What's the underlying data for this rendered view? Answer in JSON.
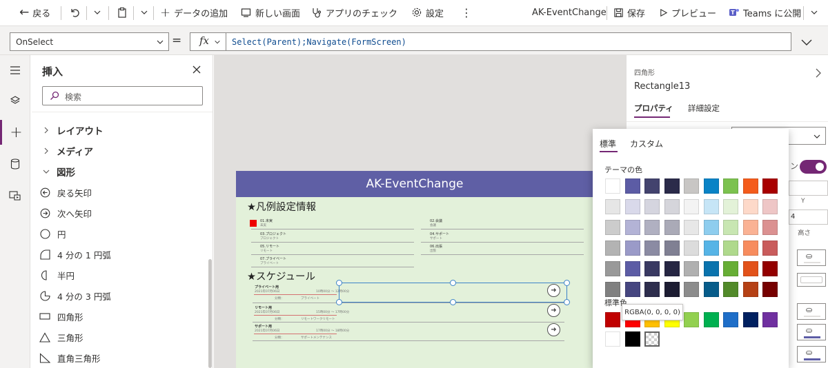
{
  "topbar": {
    "back": "戻る",
    "add_data": "データの追加",
    "new_screen": "新しい画面",
    "app_checker": "アプリのチェック",
    "settings": "設定",
    "app_name": "AK-EventChange",
    "save": "保存",
    "preview": "プレビュー",
    "publish_teams": "Teams に公開"
  },
  "formula_bar": {
    "property": "OnSelect",
    "equals": "=",
    "fx": "fx",
    "formula": "Select(Parent);Navigate(FormScreen)"
  },
  "insert_panel": {
    "title": "挿入",
    "search_placeholder": "検索",
    "categories": [
      "レイアウト",
      "メディア",
      "図形"
    ],
    "items": [
      "戻る矢印",
      "次へ矢印",
      "円",
      "4 分の 1 円弧",
      "半円",
      "4 分の 3 円弧",
      "四角形",
      "三角形",
      "直角三角形"
    ]
  },
  "app_screen": {
    "header": "AK-EventChange",
    "legend_title": "★凡例設定情報",
    "legend_left": [
      {
        "code": "01.未実",
        "sub": "未実"
      },
      {
        "code": "03.プロジェクト",
        "sub": "プロジェクト"
      },
      {
        "code": "05.リモート",
        "sub": "リモート"
      },
      {
        "code": "07.プライベート",
        "sub": "プライベート"
      }
    ],
    "legend_right": [
      {
        "code": "02.会議",
        "sub": "会議"
      },
      {
        "code": "04.サポート",
        "sub": "サポート"
      },
      {
        "code": "06.出張",
        "sub": "出張"
      }
    ],
    "schedule_title": "★スケジュール",
    "schedule": [
      {
        "title": "プライベート用",
        "date": "2021年07月06日",
        "time": "10時00分 ～ 12時00分",
        "tag_label": "分類：",
        "tag": "プライベート"
      },
      {
        "title": "リモート用",
        "date": "2021年07月06日",
        "time": "15時00分 ～ 17時00分",
        "tag_label": "分類：",
        "tag": "リモートワークリモート"
      },
      {
        "title": "サポート用",
        "date": "2021年07月06日",
        "time": "17時00分 ～ 18時00分",
        "tag_label": "分類：",
        "tag": "サポートメンテナンス"
      }
    ]
  },
  "properties_panel": {
    "type": "四角形",
    "name": "Rectangle13",
    "tabs": [
      "プロパティ",
      "詳細設定"
    ],
    "y_label": "Y",
    "height_label": "高さ",
    "value_fragment": "4"
  },
  "color_picker": {
    "tabs": [
      "標準",
      "カスタム"
    ],
    "theme_label": "テーマの色",
    "standard_label": "標準色",
    "tooltip": "RGBA(0, 0, 0, 0)",
    "theme_rows": [
      [
        "#ffffff",
        "#5c5ca5",
        "#43436e",
        "#2b2b4a",
        "#c8c6c4",
        "#0a83c6",
        "#7cc24f",
        "#f45c1c",
        "#a80000"
      ],
      [
        "#e6e6e6",
        "#d9d9ea",
        "#d5d5df",
        "#d5d5db",
        "#f3f3f3",
        "#c6e5f6",
        "#e3f2d8",
        "#fdd9c9",
        "#eec6c6"
      ],
      [
        "#cccccc",
        "#b3b3d6",
        "#b0b0c1",
        "#aaaab7",
        "#e7e7e7",
        "#8ecdee",
        "#c8e6b2",
        "#fab294",
        "#db9191"
      ],
      [
        "#b3b3b3",
        "#9a9ac8",
        "#8b8ba3",
        "#808093",
        "#dcdcdc",
        "#56b4e6",
        "#afd98c",
        "#f78c5e",
        "#c95c5c"
      ],
      [
        "#999999",
        "#5c5ca5",
        "#393962",
        "#262643",
        "#b0b0b0",
        "#0a73ad",
        "#67ae35",
        "#e2521a",
        "#930000"
      ],
      [
        "#808080",
        "#464680",
        "#2d2d4d",
        "#1d1d33",
        "#8c8c8c",
        "#075c8a",
        "#528a2a",
        "#b54115",
        "#760000"
      ]
    ],
    "standard_rows": [
      [
        "#c00000",
        "#ff0000",
        "#ffc000",
        "#ffff00",
        "#92d050",
        "#00b050",
        "#1e6ec8",
        "#002060",
        "#7030a0"
      ],
      [
        "#ffffff",
        "#000000",
        "transparent"
      ]
    ]
  }
}
